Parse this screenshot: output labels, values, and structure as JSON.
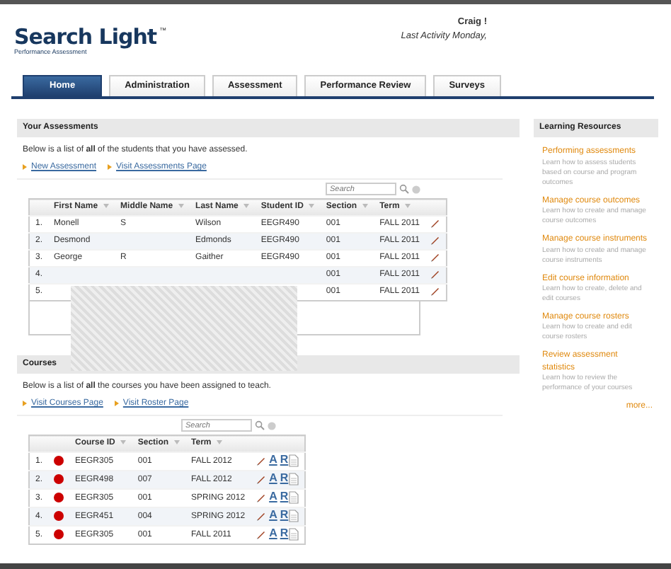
{
  "header": {
    "logo_title": "Search Light",
    "logo_mark": "™",
    "logo_subtitle": "Performance Assessment",
    "user": "Craig !",
    "last_activity": "Last Activity Monday,"
  },
  "tabs": [
    {
      "label": "Home",
      "selected": true
    },
    {
      "label": "Administration",
      "selected": false
    },
    {
      "label": "Assessment",
      "selected": false
    },
    {
      "label": "Performance Review",
      "selected": false
    },
    {
      "label": "Surveys",
      "selected": false
    }
  ],
  "assessments": {
    "title": "Your Assessments",
    "intro": "Below is a list of **all** of the students that you have assessed.",
    "links": [
      "New Assessment",
      "Visit Assessments Page"
    ],
    "search": {
      "placeholder": "Search"
    },
    "columns": [
      "",
      "First Name",
      "Middle Name",
      "Last Name",
      "Student ID",
      "Section",
      "Term"
    ],
    "rows": [
      [
        "1.",
        "Monell",
        "S",
        "Wilson",
        "EEGR490",
        "001",
        "FALL 2011"
      ],
      [
        "2.",
        "Desmond",
        "",
        "Edmonds",
        "EEGR490",
        "001",
        "FALL 2011"
      ],
      [
        "3.",
        "George",
        "R",
        "Gaither",
        "EEGR490",
        "001",
        "FALL 2011"
      ],
      [
        "4.",
        "",
        "",
        "",
        "",
        "001",
        "FALL 2011"
      ],
      [
        "5.",
        "",
        "",
        "",
        "",
        "001",
        "FALL 2011"
      ]
    ]
  },
  "courses": {
    "title": "Courses",
    "intro": "Below is a list of **all** the courses you have been assigned to teach.",
    "links": [
      "Visit Courses Page",
      "Visit Roster Page"
    ],
    "search": {
      "placeholder": "Search"
    },
    "columns": [
      "",
      "Course ID",
      "Section",
      "Term"
    ],
    "rows": [
      {
        "cells": [
          "1.",
          "EEGR305",
          "001",
          "FALL 2012"
        ],
        "action_letters": [
          "A",
          "R"
        ]
      },
      {
        "cells": [
          "2.",
          "EEGR498",
          "007",
          "FALL 2012"
        ],
        "action_letters": [
          "A",
          "R"
        ]
      },
      {
        "cells": [
          "3.",
          "EEGR305",
          "001",
          "SPRING 2012"
        ],
        "action_letters": [
          "A",
          "R"
        ]
      },
      {
        "cells": [
          "4.",
          "EEGR451",
          "004",
          "SPRING 2012"
        ],
        "action_letters": [
          "A",
          "R"
        ]
      },
      {
        "cells": [
          "5.",
          "EEGR305",
          "001",
          "FALL 2011"
        ],
        "action_letters": [
          "A",
          "R"
        ]
      }
    ]
  },
  "learning_resources": {
    "title": "Learning Resources",
    "items": [
      {
        "title": "Performing assessments",
        "description": "Learn how to assess students based on course and program outcomes"
      },
      {
        "title": "Manage course outcomes",
        "description": "Learn how to create and manage course outcomes"
      },
      {
        "title": "Manage course instruments",
        "description": "Learn how to create and manage course instruments"
      },
      {
        "title": "Edit course information",
        "description": "Learn how to create, delete and edit courses"
      },
      {
        "title": "Manage course rosters",
        "description": "Learn how to create and edit course rosters"
      },
      {
        "title": "Review assessment statistics",
        "description": "Learn how to review the performance of your courses"
      }
    ],
    "more": "more..."
  }
}
